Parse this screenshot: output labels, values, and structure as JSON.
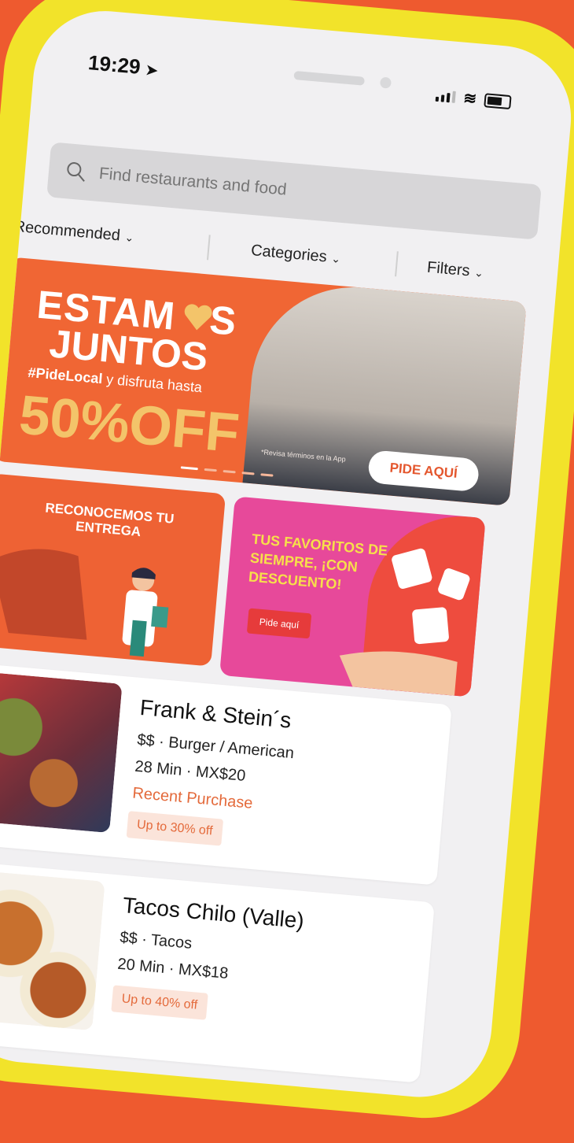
{
  "status_bar": {
    "time": "19:29"
  },
  "search": {
    "placeholder": "Find restaurants and food"
  },
  "filters": [
    {
      "label": "Recommended"
    },
    {
      "label": "Categories"
    },
    {
      "label": "Filters"
    }
  ],
  "banner": {
    "line1": "ESTAM",
    "line1_end": "S",
    "line2": "JUNTOS",
    "hashtag": "#PideLocal",
    "subline": " y disfruta hasta",
    "discount": "50%OFF",
    "note": "*Revisa términos en la App",
    "cta": "PIDE AQUÍ"
  },
  "promos": [
    {
      "title": "RECONOCEMOS TU ENTREGA"
    },
    {
      "title": "TUS FAVORITOS DE SIEMPRE, ¡CON DESCUENTO!",
      "cta": "Pide aquí"
    }
  ],
  "restaurants": [
    {
      "name": "Frank & Stein´s",
      "meta": "$$ · Burger / American",
      "delivery": "28 Min · MX$20",
      "tag": "Recent Purchase",
      "deal": "Up to 30% off"
    },
    {
      "name": "Tacos Chilo (Valle)",
      "meta": "$$ · Tacos",
      "delivery": "20 Min · MX$18",
      "deal": "Up to 40% off"
    }
  ],
  "colors": {
    "background": "#ee5a2f",
    "phone_frame": "#f2e32a",
    "accent": "#e46a3b"
  }
}
